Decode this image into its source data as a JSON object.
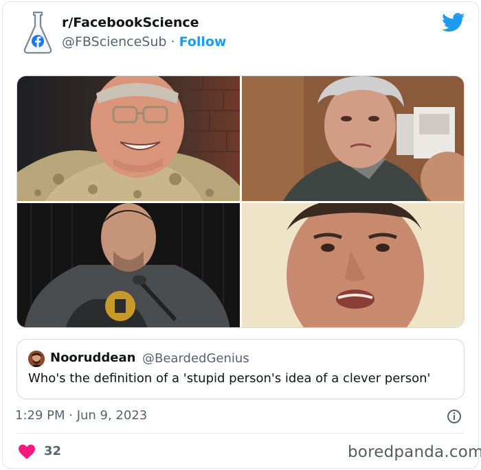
{
  "tweet": {
    "author_name": "r/FacebookScience",
    "author_handle": "@FBScienceSub",
    "separator": "·",
    "follow_label": "Follow",
    "timestamp": "1:29 PM · Jun 9, 2023",
    "like_count": "32"
  },
  "quoted_tweet": {
    "author_name": "Nooruddean",
    "author_handle": "@BeardedGenius",
    "text": "Who's the definition of a 'stupid person's idea of a clever person'"
  },
  "watermark": "boredpanda.com",
  "icons": {
    "avatar": "flask-facebook-icon",
    "platform": "twitter-bird-icon",
    "info": "info-icon",
    "like": "heart-icon"
  },
  "colors": {
    "accent": "#1d9bf0",
    "like": "#f91880",
    "muted_text": "#536471"
  }
}
